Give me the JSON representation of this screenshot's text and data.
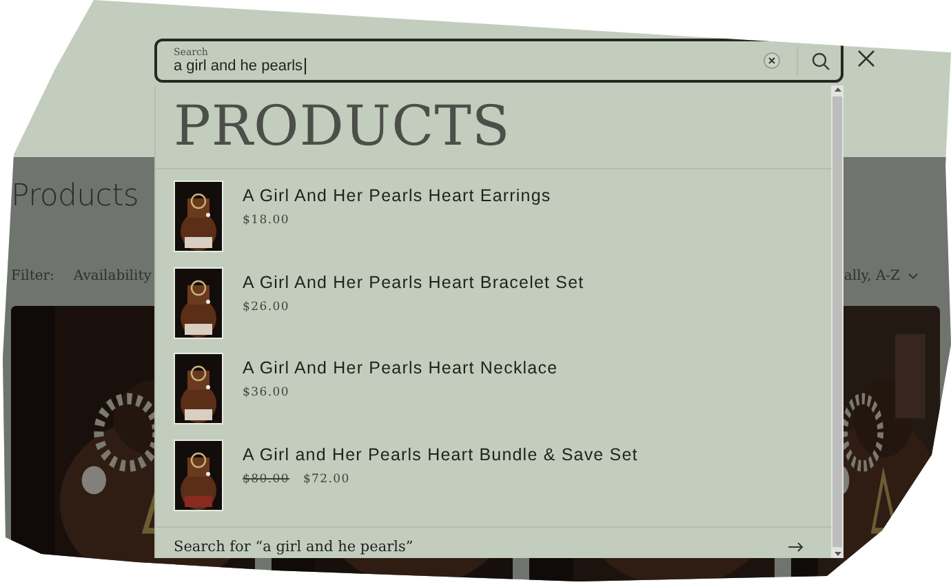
{
  "page": {
    "title": "Products",
    "filter_label": "Filter:",
    "filters": [
      "Availability"
    ],
    "sort_label": "ally, A-Z"
  },
  "search": {
    "label": "Search",
    "value": "a girl and he pearls"
  },
  "predictive": {
    "heading": "PRODUCTS",
    "products": [
      {
        "title": "A Girl And Her Pearls Heart Earrings",
        "price": "$18.00"
      },
      {
        "title": "A Girl And Her Pearls Heart Bracelet Set",
        "price": "$26.00"
      },
      {
        "title": "A Girl And Her Pearls Heart Necklace",
        "price": "$36.00"
      },
      {
        "title": "A Girl and Her Pearls Heart Bundle & Save Set",
        "compare_price": "$80.00",
        "price": "$72.00"
      }
    ],
    "search_for": "Search for “a girl and he pearls”"
  }
}
